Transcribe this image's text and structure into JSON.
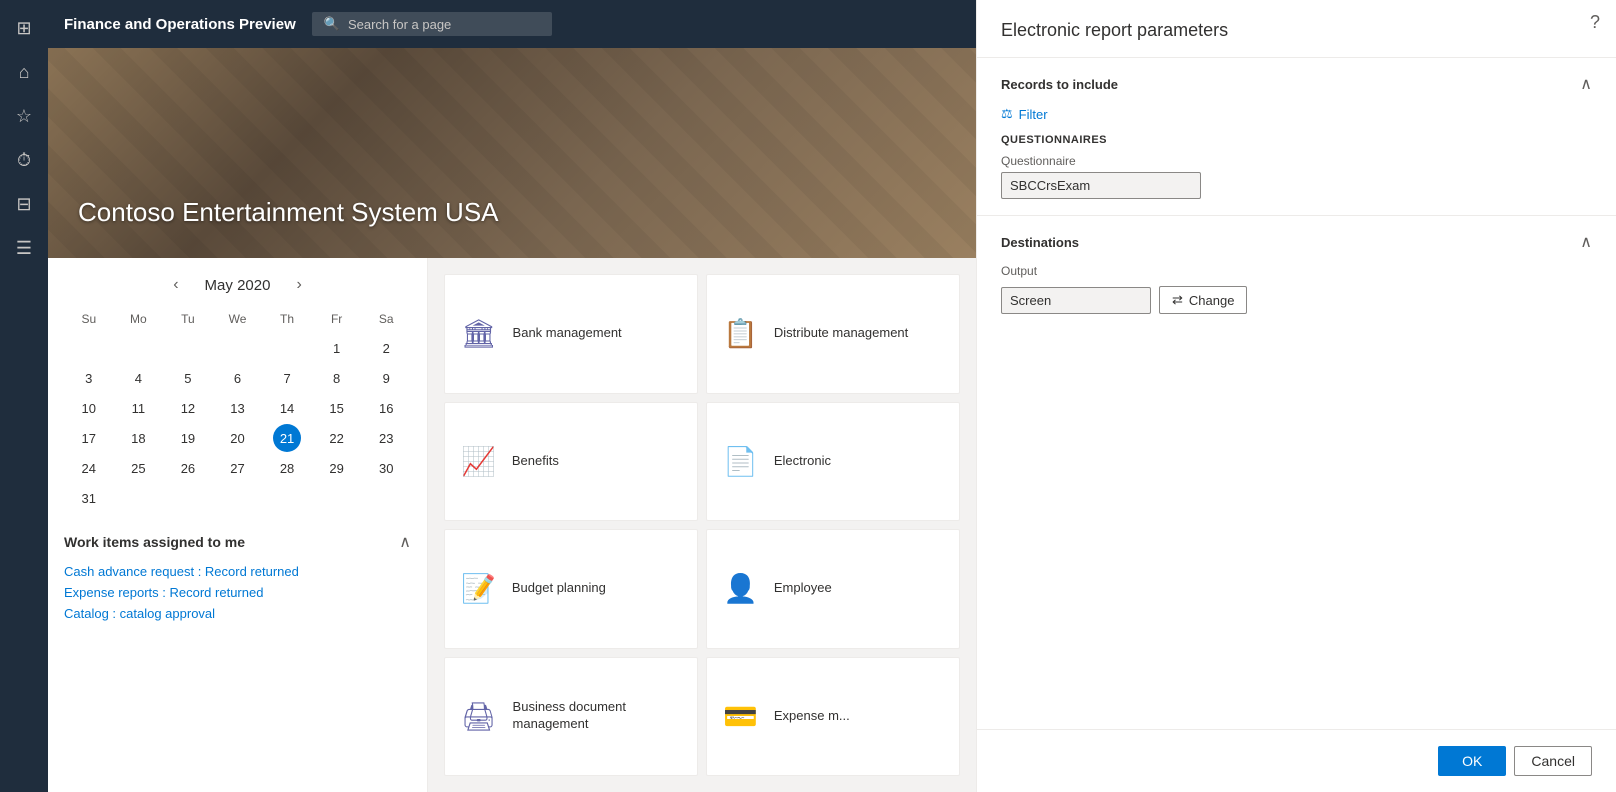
{
  "app": {
    "title": "Finance and Operations Preview",
    "search_placeholder": "Search for a page"
  },
  "banner": {
    "company_name": "Contoso Entertainment System USA"
  },
  "calendar": {
    "month": "May",
    "year": "2020",
    "day_headers": [
      "Su",
      "Mo",
      "Tu",
      "We",
      "Th",
      "Fr",
      "Sa"
    ],
    "today": 21,
    "weeks": [
      [
        null,
        null,
        null,
        null,
        null,
        1,
        2
      ],
      [
        3,
        4,
        5,
        6,
        7,
        8,
        9
      ],
      [
        10,
        11,
        12,
        13,
        14,
        15,
        16
      ],
      [
        17,
        18,
        19,
        20,
        21,
        22,
        23
      ],
      [
        24,
        25,
        26,
        27,
        28,
        29,
        30
      ],
      [
        31,
        null,
        null,
        null,
        null,
        null,
        null
      ]
    ]
  },
  "work_items": {
    "title": "Work items assigned to me",
    "collapse_label": "^",
    "items": [
      "Cash advance request : Record returned",
      "Expense reports : Record returned",
      "Catalog : catalog approval"
    ]
  },
  "tiles": [
    {
      "id": "bank",
      "icon": "🏛",
      "label": "Bank management"
    },
    {
      "id": "distribute",
      "icon": "📋",
      "label": "Distribute management"
    },
    {
      "id": "benefits",
      "icon": "📈",
      "label": "Benefits"
    },
    {
      "id": "electronic",
      "icon": "📄",
      "label": "Electronic"
    },
    {
      "id": "budget",
      "icon": "📝",
      "label": "Budget planning"
    },
    {
      "id": "employee",
      "icon": "👤",
      "label": "Employee"
    },
    {
      "id": "business-doc",
      "icon": "🖨",
      "label": "Business document management"
    },
    {
      "id": "expense",
      "icon": "💳",
      "label": "Expense m..."
    }
  ],
  "right_panel": {
    "title": "Electronic report parameters",
    "records_section": {
      "label": "Records to include",
      "filter_label": "Filter",
      "subsection_label": "QUESTIONNAIRES",
      "questionnaire_field_label": "Questionnaire",
      "questionnaire_value": "SBCCrsExam"
    },
    "destinations_section": {
      "label": "Destinations",
      "output_field_label": "Output",
      "output_value": "Screen",
      "change_button_label": "Change"
    },
    "ok_label": "OK",
    "cancel_label": "Cancel"
  },
  "nav": {
    "icons": [
      {
        "name": "grid-icon",
        "glyph": "⊞"
      },
      {
        "name": "home-icon",
        "glyph": "⌂"
      },
      {
        "name": "favorites-icon",
        "glyph": "☆"
      },
      {
        "name": "recent-icon",
        "glyph": "⏱"
      },
      {
        "name": "workspaces-icon",
        "glyph": "⊡"
      },
      {
        "name": "modules-icon",
        "glyph": "☰"
      }
    ]
  }
}
